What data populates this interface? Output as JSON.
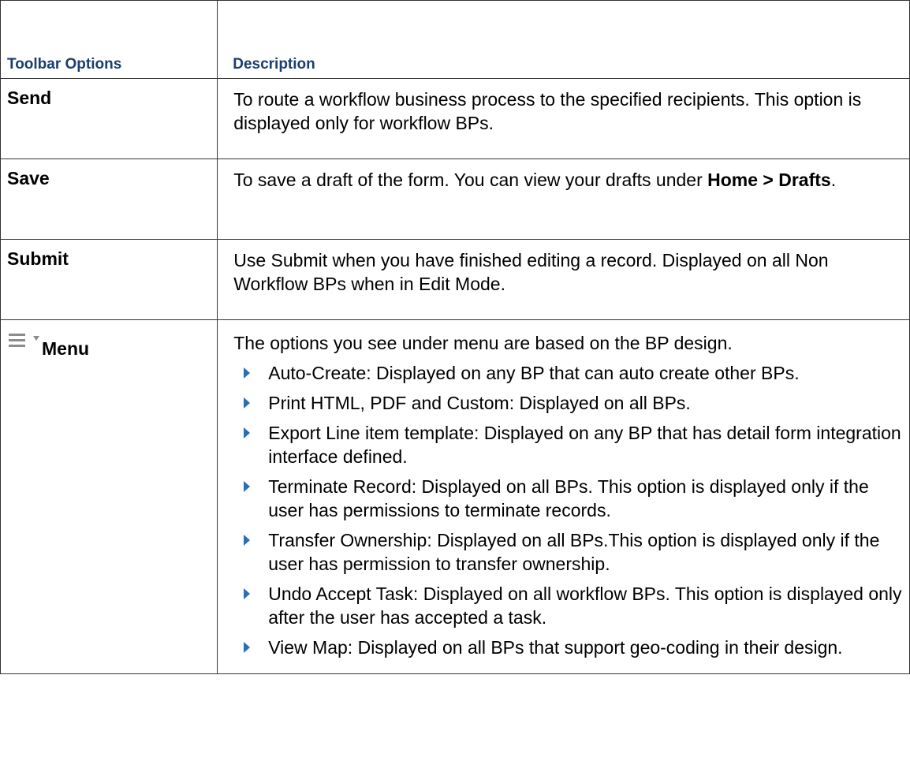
{
  "table": {
    "headers": {
      "options": "Toolbar Options",
      "description": "Description"
    },
    "rows": {
      "send": {
        "option": "Send",
        "description": "To route a workflow business process to the specified recipients. This option is displayed only for workflow BPs."
      },
      "save": {
        "option": "Save",
        "description_before": "To save a draft of the form. You can view your drafts under ",
        "description_bold": "Home > Drafts",
        "description_after": "."
      },
      "submit": {
        "option": "Submit",
        "description": "Use Submit when you have finished editing a record. Displayed on all Non Workflow BPs when in Edit Mode."
      },
      "menu": {
        "option": "Menu",
        "icons": [
          "hamburger-icon",
          "caret-down-icon"
        ],
        "intro": "The options you see under menu are based on the BP design.",
        "items": [
          "Auto-Create: Displayed on any BP that can auto create other BPs.",
          "Print HTML, PDF and Custom: Displayed on all BPs.",
          "Export Line item template: Displayed on any BP that has detail form integration interface defined.",
          "Terminate Record: Displayed on all BPs. This option is displayed only if the user has permissions to terminate records.",
          "Transfer Ownership: Displayed on all BPs.This option is displayed only if the user has permission to transfer ownership.",
          "Undo Accept Task: Displayed on all workflow BPs. This option is displayed only after the user has accepted a task.",
          "View Map: Displayed on all BPs that support geo-coding in their design."
        ]
      }
    }
  },
  "colors": {
    "header_text": "#1a3e6e",
    "bullet": "#2a6db5",
    "border": "#333333",
    "icon": "#8c8c8c"
  }
}
